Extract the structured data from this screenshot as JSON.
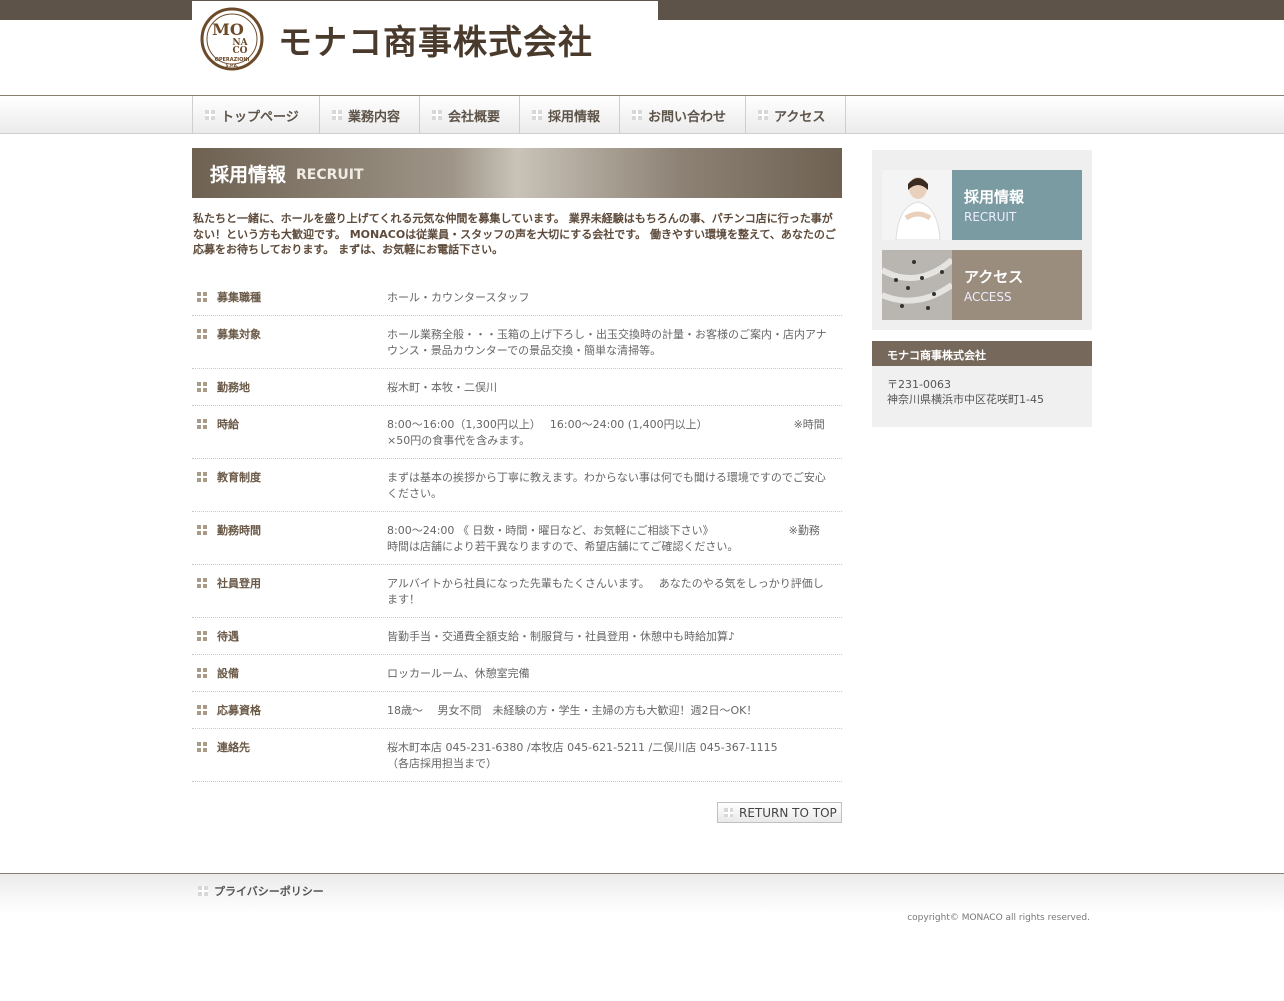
{
  "header": {
    "logo_mark_lines": [
      "MO",
      "NA",
      "CO",
      "OPERAZIONI",
      "S.P.A."
    ],
    "company_name": "モナコ商事株式会社"
  },
  "nav": {
    "items": [
      {
        "label": "トップページ"
      },
      {
        "label": "業務内容"
      },
      {
        "label": "会社概要"
      },
      {
        "label": "採用情報"
      },
      {
        "label": "お問い合わせ"
      },
      {
        "label": "アクセス"
      }
    ]
  },
  "main": {
    "title_jp": "採用情報",
    "title_en": "RECRUIT",
    "intro": "私たちと一緒に、ホールを盛り上げてくれる元気な仲間を募集しています。 業界未経験はもちろんの事、パチンコ店に行った事がない！という方も大歓迎です。 MONACOは従業員・スタッフの声を大切にする会社です。 働きやすい環境を整えて、あなたのご応募をお待ちしております。 まずは、お気軽にお電話下さい。",
    "rows": [
      {
        "label": "募集職種",
        "value": "ホール・カウンタースタッフ"
      },
      {
        "label": "募集対象",
        "value": "ホール業務全般・・・玉箱の上げ下ろし・出玉交換時の計量・お客様のご案内・店内アナウンス・景品カウンターでの景品交換・簡単な清掃等。"
      },
      {
        "label": "勤務地",
        "value": "桜木町・本牧・二俣川"
      },
      {
        "label": "時給",
        "value": "8:00～16:00（1,300円以上）　 16:00～24:00 (1,400円以上）　　　　　　　　 ※時間×50円の食事代を含みます。"
      },
      {
        "label": "教育制度",
        "value": "まずは基本の挨拶から丁寧に教えます。わからない事は何でも聞ける環境ですのでご安心ください。"
      },
      {
        "label": "勤務時間",
        "value": "8:00～24:00 《 日数・時間・曜日など、お気軽にご相談下さい》　　　　　　　 ※勤務時間は店舗により若干異なりますので、希望店舗にてご確認ください。"
      },
      {
        "label": "社員登用",
        "value": "アルバイトから社員になった先輩もたくさんいます。　 あなたのやる気をしっかり評価します！"
      },
      {
        "label": "待遇",
        "value": "皆勤手当・交通費全額支給・制服貸与・社員登用・休憩中も時給加算♪"
      },
      {
        "label": "設備",
        "value": "ロッカールーム、休憩室完備"
      },
      {
        "label": "応募資格",
        "value": "18歳～　 男女不問　未経験の方・学生・主婦の方も大歓迎！週2日～OK！"
      },
      {
        "label": "連絡先",
        "value": "桜木町本店 045-231-6380 /本牧店 045-621-5211 /二俣川店 045-367-1115　　　（各店採用担当まで）"
      }
    ],
    "return_label": "RETURN TO TOP"
  },
  "sidebar": {
    "banners": [
      {
        "jp": "採用情報",
        "en": "RECRUIT",
        "color": "#7a9ba1"
      },
      {
        "jp": "アクセス",
        "en": "ACCESS",
        "color": "#9a8d7e"
      }
    ],
    "company_title": "モナコ商事株式会社",
    "postal": "〒231-0063",
    "address": "神奈川県横浜市中区花咲町1-45"
  },
  "footer": {
    "privacy_label": "プライバシーポリシー",
    "copyright": "copyright© MONACO all rights reserved."
  },
  "colors": {
    "topbar": "#5d5348",
    "accent_brown": "#76695b",
    "logo_brown": "#6b4a2a"
  }
}
